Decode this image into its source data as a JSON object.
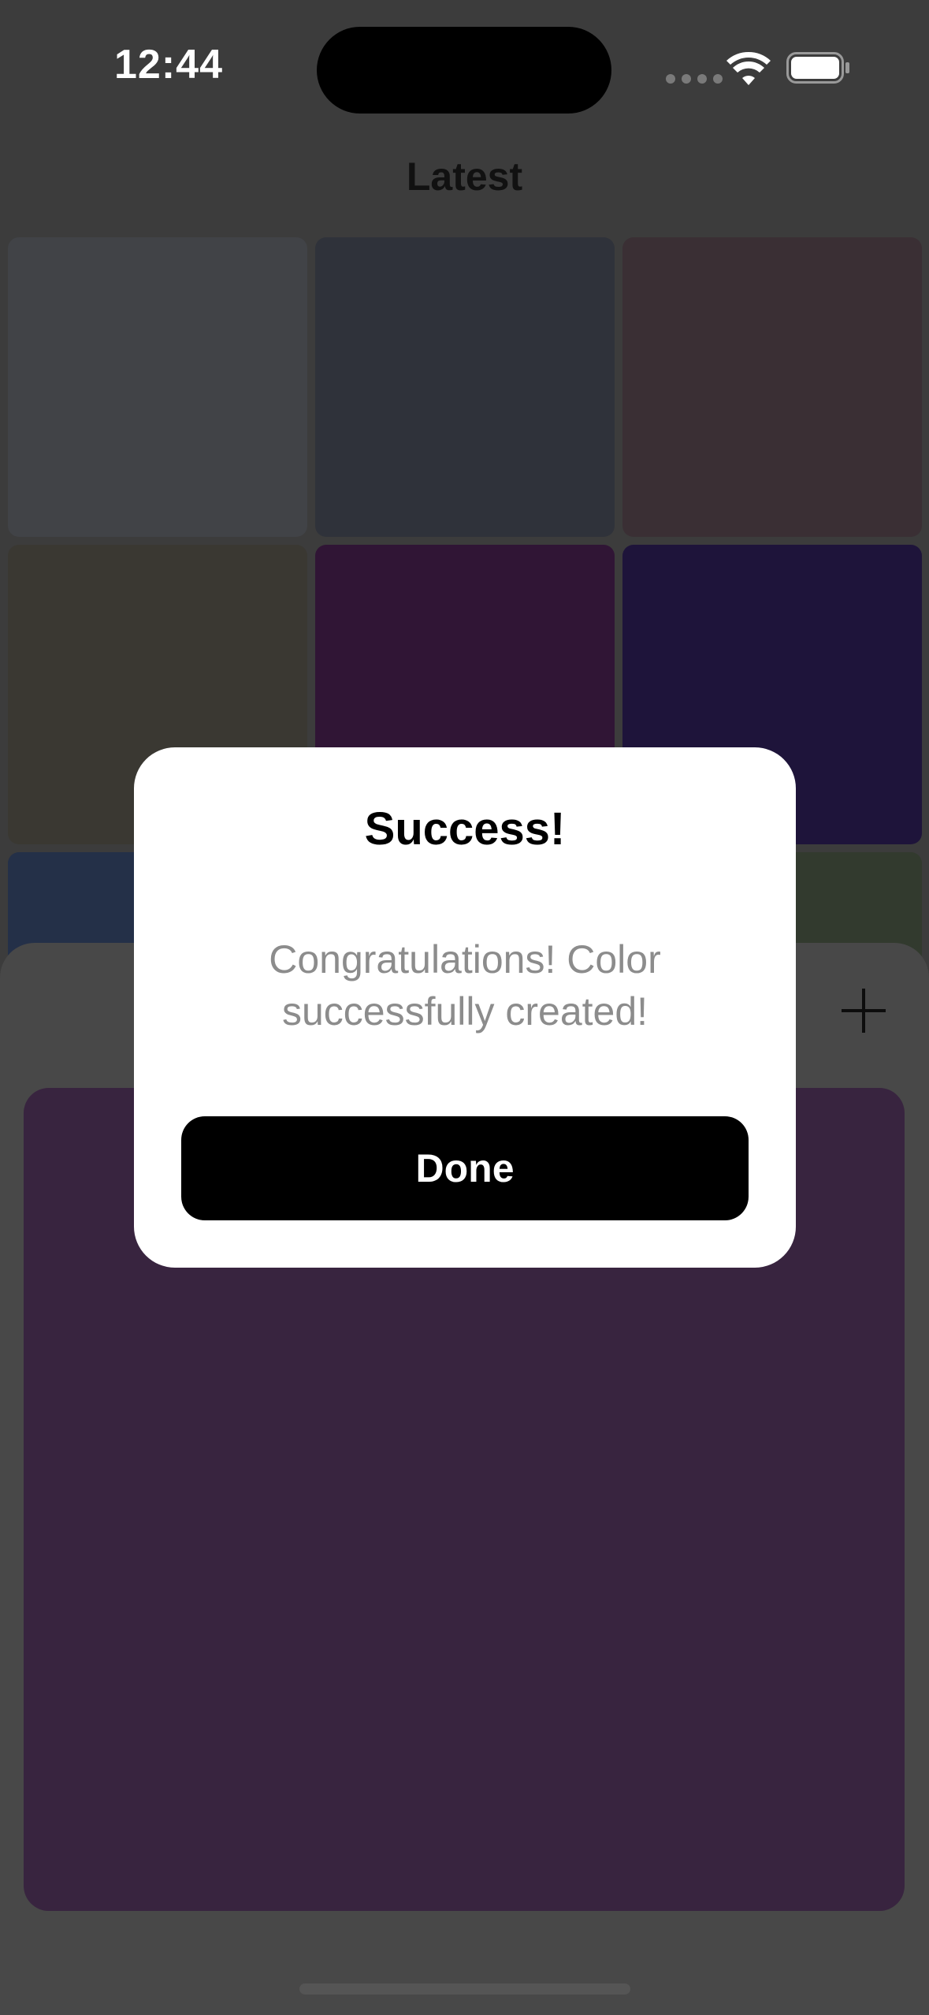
{
  "status_bar": {
    "time": "12:44",
    "icons": [
      "signal-dots-icon",
      "wifi-icon",
      "battery-icon"
    ]
  },
  "page": {
    "title": "Latest"
  },
  "grid": {
    "tiles": [
      {
        "color": "#414347"
      },
      {
        "color": "#2f323a"
      },
      {
        "color": "#3a2f34"
      },
      {
        "color": "#3a3832"
      },
      {
        "color": "#301535"
      },
      {
        "color": "#1e143a"
      },
      {
        "color": "#243048"
      },
      {
        "color": "#3a3a3a"
      },
      {
        "color": "#323a2e"
      }
    ]
  },
  "sheet": {
    "add_icon": "plus-icon",
    "preview_color": "#38243f"
  },
  "alert": {
    "title": "Success!",
    "message": "Congratulations! Color successfully created!",
    "done_label": "Done"
  }
}
